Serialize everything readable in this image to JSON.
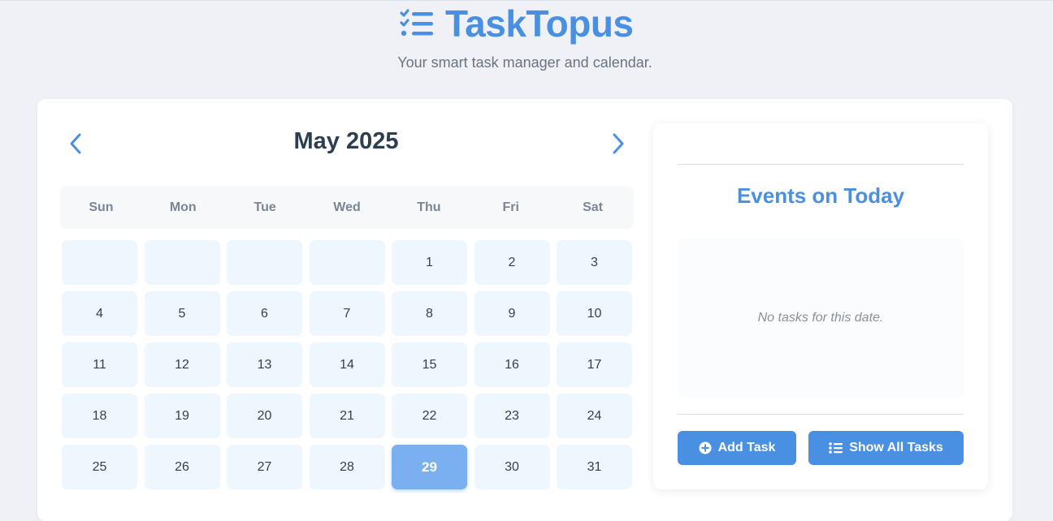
{
  "app": {
    "title": "TaskTopus",
    "subtitle": "Your smart task manager and calendar.",
    "logo_icon": "checklist-icon",
    "accent_color": "#4a90e2"
  },
  "calendar": {
    "month_label": "May 2025",
    "prev_icon": "chevron-left-icon",
    "next_icon": "chevron-right-icon",
    "weekdays": [
      "Sun",
      "Mon",
      "Tue",
      "Wed",
      "Thu",
      "Fri",
      "Sat"
    ],
    "leading_blanks": 4,
    "days": [
      "1",
      "2",
      "3",
      "4",
      "5",
      "6",
      "7",
      "8",
      "9",
      "10",
      "11",
      "12",
      "13",
      "14",
      "15",
      "16",
      "17",
      "18",
      "19",
      "20",
      "21",
      "22",
      "23",
      "24",
      "25",
      "26",
      "27",
      "28",
      "29",
      "30",
      "31"
    ],
    "selected_day": "29",
    "selected_color": "#7aaff0"
  },
  "events_panel": {
    "title": "Events on Today",
    "empty_message": "No tasks for this date.",
    "add_button": {
      "label": "Add Task",
      "icon": "plus-circle-icon"
    },
    "show_all_button": {
      "label": "Show All Tasks",
      "icon": "list-icon"
    }
  }
}
